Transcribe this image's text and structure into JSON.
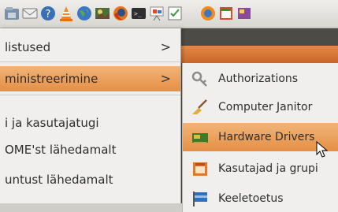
{
  "panel": {
    "icons": [
      "home-folder-icon",
      "mail-icon",
      "help-icon",
      "vlc-cone-icon",
      "globe-icon",
      "image-viewer-icon",
      "firefox-icon",
      "terminal-icon",
      "presentation-icon",
      "checklist-icon",
      "network-icon",
      "notes-icon",
      "update-icon"
    ]
  },
  "main_menu": {
    "items": [
      {
        "label": "listused",
        "has_submenu": true
      },
      {
        "label": "ministreerimine",
        "has_submenu": true,
        "active": true
      },
      {
        "label": "i ja kasutajatugi"
      },
      {
        "label": "OME'st lähedamalt"
      },
      {
        "label": "untust lähedamalt"
      }
    ],
    "chevron": ">"
  },
  "sub_menu": {
    "items": [
      {
        "label": "Authorizations",
        "icon": "keys-icon"
      },
      {
        "label": "Computer Janitor",
        "icon": "broom-icon"
      },
      {
        "label": "Hardware Drivers",
        "icon": "hardware-card-icon",
        "active": true
      },
      {
        "label": "Kasutajad ja grupi",
        "icon": "users-groups-icon"
      },
      {
        "label": "Keeletoetus",
        "icon": "flag-icon"
      }
    ]
  },
  "colors": {
    "highlight": "#e9994f",
    "menu_bg": "#f0efed",
    "panel_bg": "#e4e2de"
  }
}
